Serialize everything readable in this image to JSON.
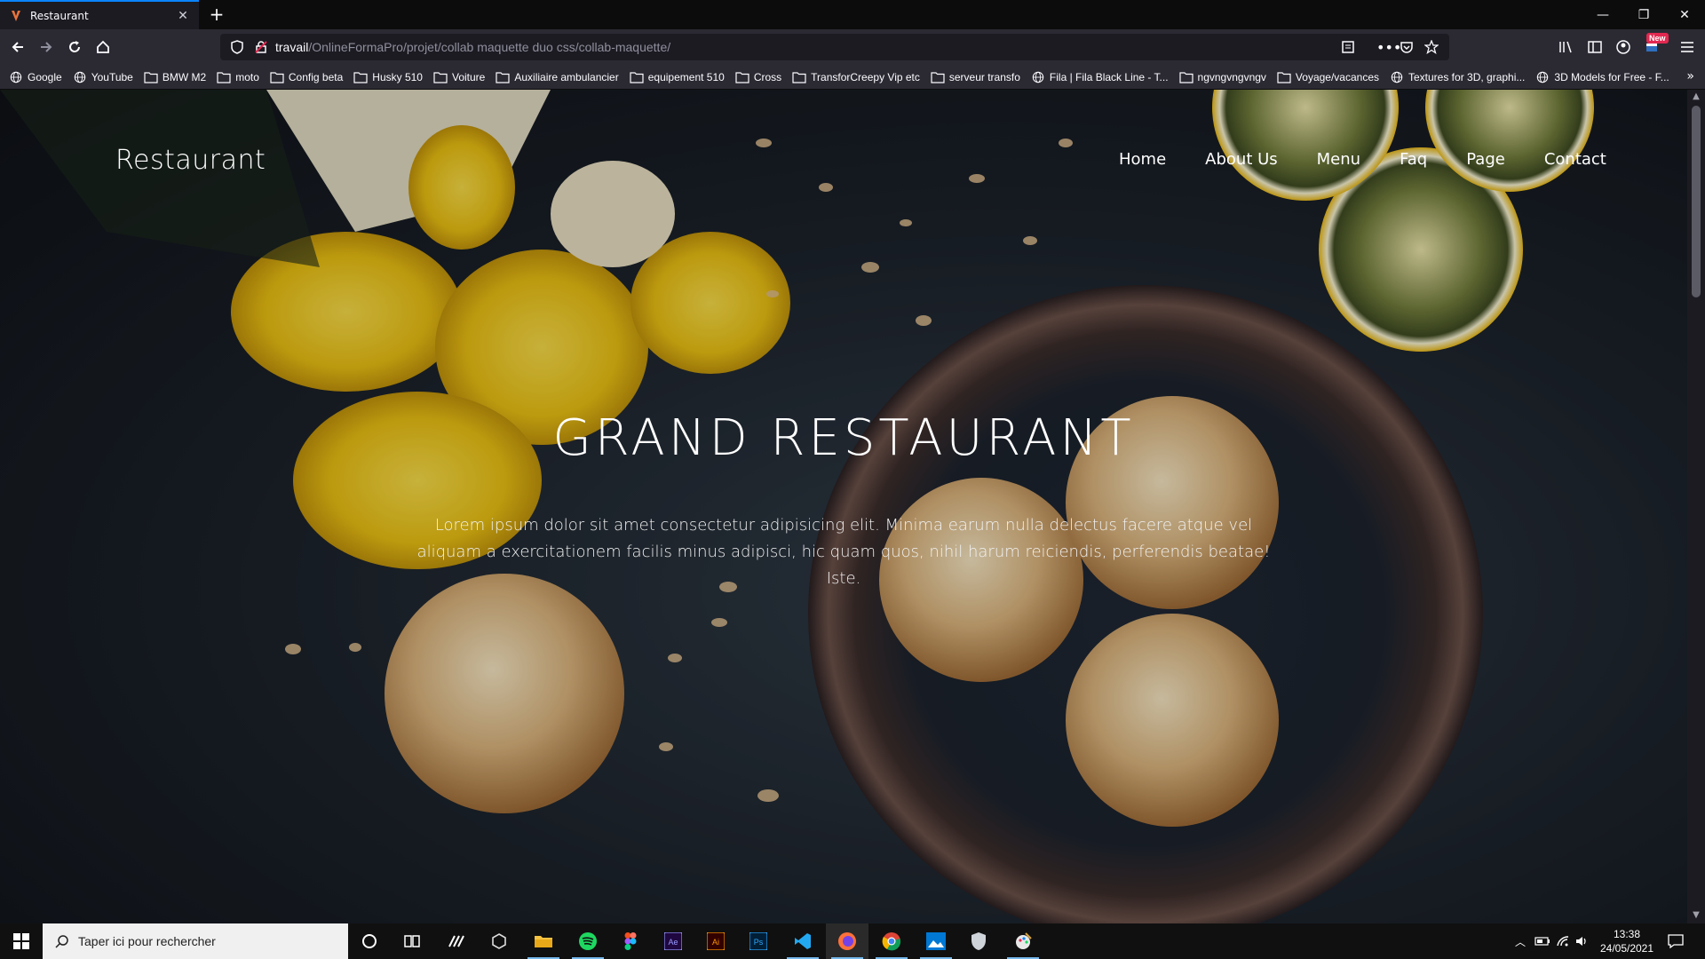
{
  "browser": {
    "tab_title": "Restaurant",
    "url_host": "travail",
    "url_path": "/OnlineFormaPro/projet/collab maquette duo css/collab-maquette/",
    "new_badge": "New",
    "bookmarks": [
      {
        "label": "Google",
        "icon": "globe-icon"
      },
      {
        "label": "YouTube",
        "icon": "globe-icon"
      },
      {
        "label": "BMW M2",
        "icon": "folder-icon"
      },
      {
        "label": "moto",
        "icon": "folder-icon"
      },
      {
        "label": "Config beta",
        "icon": "folder-icon"
      },
      {
        "label": "Husky 510",
        "icon": "folder-icon"
      },
      {
        "label": "Voiture",
        "icon": "folder-icon"
      },
      {
        "label": "Auxiliaire ambulancier",
        "icon": "folder-icon"
      },
      {
        "label": "equipement 510",
        "icon": "folder-icon"
      },
      {
        "label": "Cross",
        "icon": "folder-icon"
      },
      {
        "label": "TransforCreepy Vip etc",
        "icon": "folder-icon"
      },
      {
        "label": "serveur transfo",
        "icon": "folder-icon"
      },
      {
        "label": "Fila | Fila Black Line - T...",
        "icon": "globe-icon"
      },
      {
        "label": "ngvngvngvngv",
        "icon": "folder-icon"
      },
      {
        "label": "Voyage/vacances",
        "icon": "folder-icon"
      },
      {
        "label": "Textures for 3D, graphi...",
        "icon": "globe-icon"
      },
      {
        "label": "3D Models for Free - F...",
        "icon": "globe-icon"
      }
    ]
  },
  "site": {
    "brand": "Restaurant",
    "nav": [
      "Home",
      "About Us",
      "Menu",
      "Faq",
      "Page",
      "Contact"
    ],
    "hero_title": "GRAND RESTAURANT",
    "hero_text": "Lorem ipsum dolor sit amet consectetur adipisicing elit. Minima earum nulla delectus facere atque vel aliquam a exercitationem facilis minus adipisci, hic quam quos, nihil harum reiciendis, perferendis beatae! Iste."
  },
  "taskbar": {
    "search_placeholder": "Taper ici pour rechercher",
    "time": "13:38",
    "date": "24/05/2021"
  },
  "colors": {
    "accent": "#0a84ff",
    "chrome_dark": "#1c1b22",
    "toolbar": "#2b2a33"
  }
}
